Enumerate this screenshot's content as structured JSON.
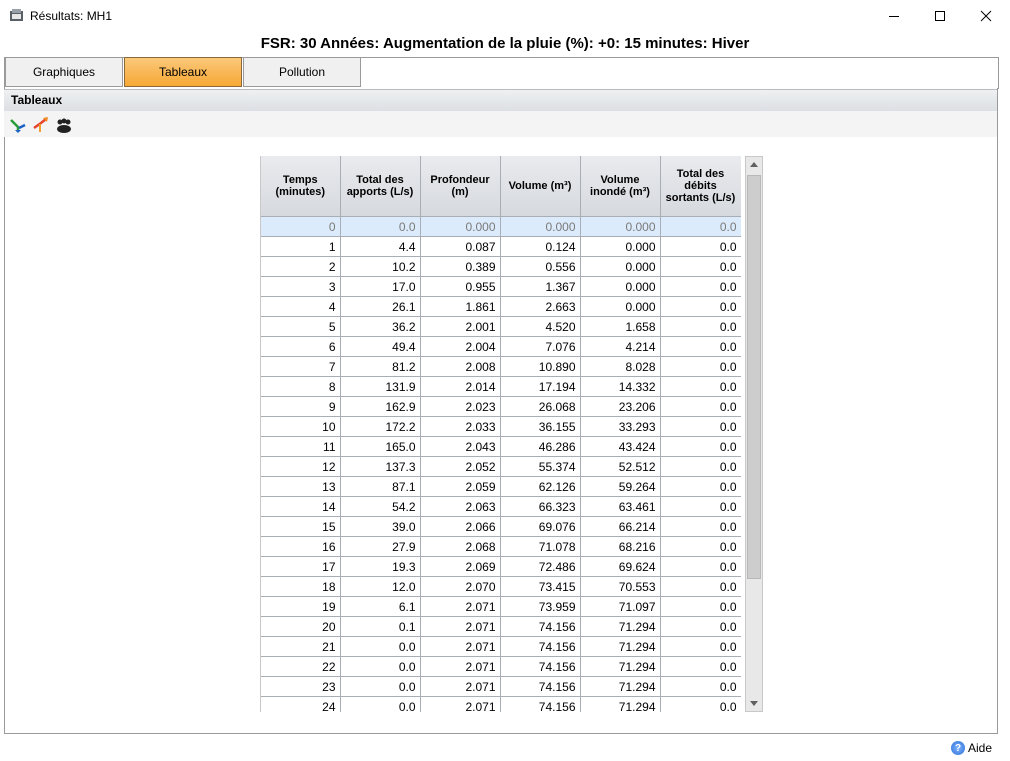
{
  "window": {
    "title": "Résultats: MH1",
    "minimize_icon": "minimize-icon",
    "maximize_icon": "maximize-icon",
    "close_icon": "close-icon"
  },
  "header": {
    "title": "FSR: 30 Années: Augmentation de la pluie (%): +0: 15 minutes: Hiver"
  },
  "tabs": [
    {
      "label": "Graphiques",
      "active": false
    },
    {
      "label": "Tableaux",
      "active": true
    },
    {
      "label": "Pollution",
      "active": false
    }
  ],
  "section": {
    "label": "Tableaux"
  },
  "toolbar": {
    "icons": [
      "arrows-green-blue-icon",
      "arrow-red-orange-icon",
      "group-people-icon"
    ]
  },
  "table": {
    "columns": [
      "Temps (minutes)",
      "Total des apports (L/s)",
      "Profondeur (m)",
      "Volume (m³)",
      "Volume inondé (m³)",
      "Total des débits sortants (L/s)"
    ],
    "selected_row": 0,
    "rows": [
      [
        "0",
        "0.0",
        "0.000",
        "0.000",
        "0.000",
        "0.0"
      ],
      [
        "1",
        "4.4",
        "0.087",
        "0.124",
        "0.000",
        "0.0"
      ],
      [
        "2",
        "10.2",
        "0.389",
        "0.556",
        "0.000",
        "0.0"
      ],
      [
        "3",
        "17.0",
        "0.955",
        "1.367",
        "0.000",
        "0.0"
      ],
      [
        "4",
        "26.1",
        "1.861",
        "2.663",
        "0.000",
        "0.0"
      ],
      [
        "5",
        "36.2",
        "2.001",
        "4.520",
        "1.658",
        "0.0"
      ],
      [
        "6",
        "49.4",
        "2.004",
        "7.076",
        "4.214",
        "0.0"
      ],
      [
        "7",
        "81.2",
        "2.008",
        "10.890",
        "8.028",
        "0.0"
      ],
      [
        "8",
        "131.9",
        "2.014",
        "17.194",
        "14.332",
        "0.0"
      ],
      [
        "9",
        "162.9",
        "2.023",
        "26.068",
        "23.206",
        "0.0"
      ],
      [
        "10",
        "172.2",
        "2.033",
        "36.155",
        "33.293",
        "0.0"
      ],
      [
        "11",
        "165.0",
        "2.043",
        "46.286",
        "43.424",
        "0.0"
      ],
      [
        "12",
        "137.3",
        "2.052",
        "55.374",
        "52.512",
        "0.0"
      ],
      [
        "13",
        "87.1",
        "2.059",
        "62.126",
        "59.264",
        "0.0"
      ],
      [
        "14",
        "54.2",
        "2.063",
        "66.323",
        "63.461",
        "0.0"
      ],
      [
        "15",
        "39.0",
        "2.066",
        "69.076",
        "66.214",
        "0.0"
      ],
      [
        "16",
        "27.9",
        "2.068",
        "71.078",
        "68.216",
        "0.0"
      ],
      [
        "17",
        "19.3",
        "2.069",
        "72.486",
        "69.624",
        "0.0"
      ],
      [
        "18",
        "12.0",
        "2.070",
        "73.415",
        "70.553",
        "0.0"
      ],
      [
        "19",
        "6.1",
        "2.071",
        "73.959",
        "71.097",
        "0.0"
      ],
      [
        "20",
        "0.1",
        "2.071",
        "74.156",
        "71.294",
        "0.0"
      ],
      [
        "21",
        "0.0",
        "2.071",
        "74.156",
        "71.294",
        "0.0"
      ],
      [
        "22",
        "0.0",
        "2.071",
        "74.156",
        "71.294",
        "0.0"
      ],
      [
        "23",
        "0.0",
        "2.071",
        "74.156",
        "71.294",
        "0.0"
      ],
      [
        "24",
        "0.0",
        "2.071",
        "74.156",
        "71.294",
        "0.0"
      ]
    ]
  },
  "footer": {
    "help_label": "Aide",
    "help_icon": "help-icon"
  },
  "colors": {
    "active_tab": "#f6a834",
    "selected_row": "#dcebfb"
  }
}
